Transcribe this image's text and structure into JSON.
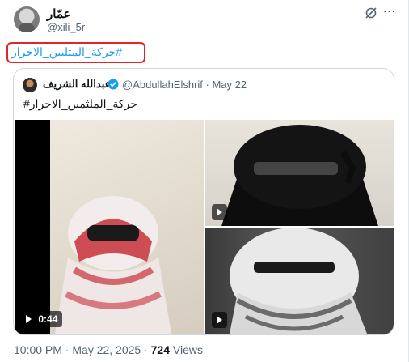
{
  "author": {
    "name": "عمّار",
    "handle": "@xili_5r"
  },
  "post": {
    "hashtag_text": "#حركة_المثليين_الاحرار"
  },
  "quoted": {
    "name": "عبدالله الشريف",
    "handle_date": "@AbdullahElshrif · May 22",
    "text": "#حركة_الملثمين_الاحرار",
    "video_duration": "0:44"
  },
  "meta": {
    "time_date": "10:00 PM · May 22, 2025 · ",
    "views_count": "724",
    "views_label": " Views"
  },
  "colors": {
    "link": "#1d9bf0",
    "highlight_border": "#e0262c",
    "verified": "#1d9bf0"
  },
  "icons": [
    "grok-icon",
    "more-icon",
    "verified-badge-icon",
    "play-icon"
  ]
}
